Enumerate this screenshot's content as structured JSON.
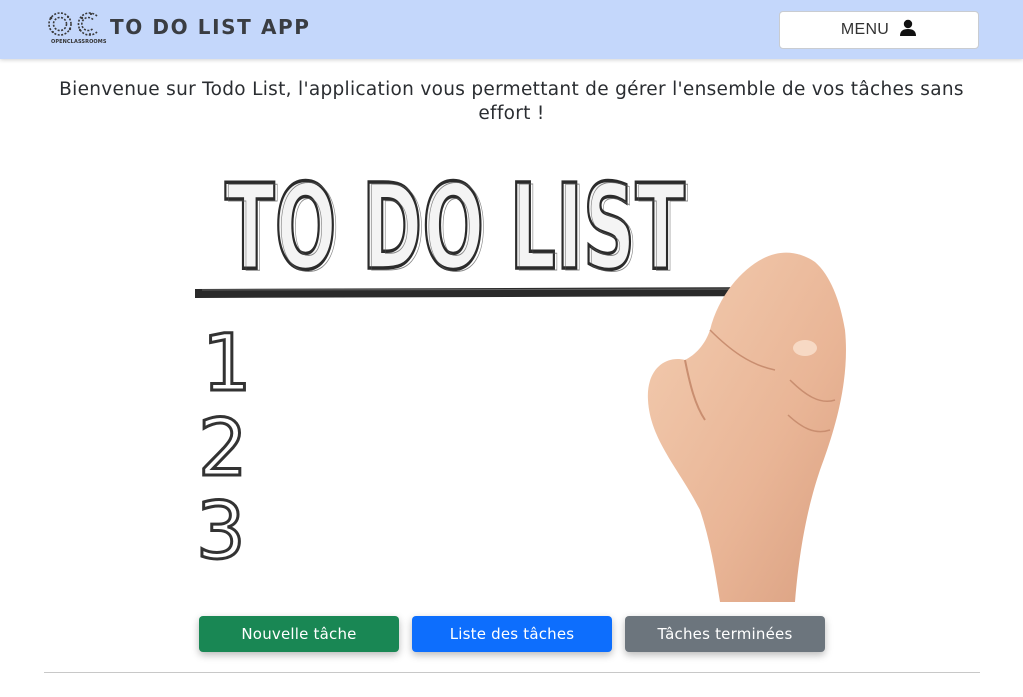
{
  "navbar": {
    "logo_icon": "openclassrooms-logo",
    "logo_text": "OPENCLASSROOMS",
    "app_title": "TO DO LIST APP",
    "menu_label": "MENU",
    "menu_icon": "user-icon"
  },
  "main": {
    "welcome_text": "Bienvenue sur Todo List, l'application vous permettant de gérer l'ensemble de vos tâches sans effort !",
    "hero_image": {
      "title": "TO DO LIST",
      "numbers": [
        "1",
        "2",
        "3"
      ]
    }
  },
  "actions": {
    "new_task": "Nouvelle tâche",
    "task_list": "Liste des tâches",
    "done_tasks": "Tâches terminées"
  },
  "colors": {
    "navbar_bg": "#c4d7fb",
    "success": "#198754",
    "primary": "#0d6efd",
    "secondary": "#6c757d"
  }
}
